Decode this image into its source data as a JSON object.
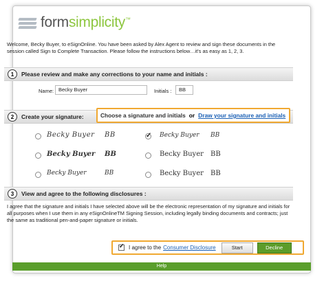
{
  "brand": {
    "logo_name_part1": "form",
    "logo_name_part2": "simplicity",
    "tm": "™"
  },
  "welcome_text": "Welcome, Becky Buyer, to eSignOnline. You have been asked by Alex Agent to review and sign these documents in the session called Sign to Complete Transaction. Please follow the instructions below…it's as easy as 1, 2, 3.",
  "step1": {
    "number": "1",
    "title": "Please review and make any corrections to your name and initials :",
    "name_label": "Name:",
    "name_value": "Becky Buyer",
    "initials_label": "Initials :",
    "initials_value": "BB"
  },
  "step2": {
    "number": "2",
    "title": "Create your signature:",
    "choose_text": "Choose a signature and initials",
    "or_text": "or",
    "draw_link": "Draw your signature and initials",
    "options": [
      {
        "signature": "Becky Buyer",
        "initials": "BB",
        "selected": false
      },
      {
        "signature": "Becky Buyer",
        "initials": "BB",
        "selected": true
      },
      {
        "signature": "Becky Buyer",
        "initials": "BB",
        "selected": false
      },
      {
        "signature": "Becky Buyer",
        "initials": "BB",
        "selected": false
      },
      {
        "signature": "Becky Buyer",
        "initials": "BB",
        "selected": false
      },
      {
        "signature": "Becky Buyer",
        "initials": "BB",
        "selected": false
      }
    ]
  },
  "step3": {
    "number": "3",
    "title": "View and agree to the following disclosures :",
    "disclosure_text": "I agree that the signature and initials I have selected above will be the electronic representation of my signature and initials for all purposes when I use them in any eSignOnlineTM Signing Session, including legally binding documents and contracts; just the same as traditional pen-and-paper signature or initials."
  },
  "actions": {
    "agree_text": "I agree to the",
    "consumer_disclosure_link": "Consumer Disclosure",
    "start_label": "Start",
    "decline_label": "Decline",
    "agree_checked": true
  },
  "footer": {
    "help_label": "Help"
  },
  "colors": {
    "accent_green": "#8dc63f",
    "highlight_orange": "#f0a830",
    "decline_green": "#5c9c2a",
    "link_blue": "#1a5fb4"
  }
}
